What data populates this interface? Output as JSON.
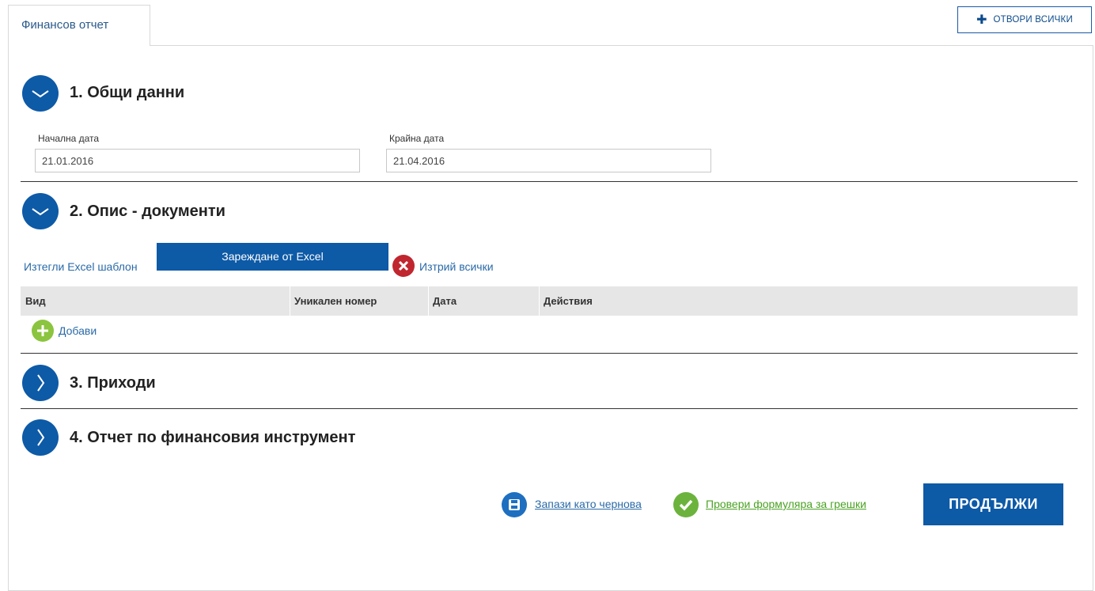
{
  "tabs": [
    {
      "label": "Финансов отчет",
      "active": true
    }
  ],
  "toolbar": {
    "expand_all_label": "ОТВОРИ ВСИЧКИ",
    "expand_all_icon": "plus-icon"
  },
  "sections": [
    {
      "title": "1. Общи данни",
      "state": "expanded",
      "icon": "chevron-down-icon"
    },
    {
      "title": "2. Опис - документи",
      "state": "expanded",
      "icon": "chevron-down-icon"
    },
    {
      "title": "3. Приходи",
      "state": "collapsed",
      "icon": "chevron-right-icon"
    },
    {
      "title": "4. Отчет по финансовия инструмент",
      "state": "collapsed",
      "icon": "chevron-right-icon"
    }
  ],
  "general": {
    "start_date_label": "Начална дата",
    "start_date_value": "21.01.2016",
    "end_date_label": "Крайна дата",
    "end_date_value": "21.04.2016"
  },
  "documents": {
    "download_template_label": "Изтегли Excel шаблон",
    "upload_excel_label": "Зареждане от Excel",
    "delete_all_label": "Изтрий всички",
    "columns": [
      "Вид",
      "Уникален номер",
      "Дата",
      "Действия"
    ],
    "rows": [],
    "add_label": "Добави"
  },
  "footer": {
    "save_draft_label": "Запази като чернова",
    "check_errors_label": "Провери формуляра за грешки",
    "continue_label": "ПРОДЪЛЖИ"
  },
  "colors": {
    "primary": "#0d5aa7",
    "link": "#2a6aa8",
    "success": "#6cb33e",
    "danger": "#c0262f",
    "add": "#8bc43f",
    "table_header_bg": "#e6e6e6"
  }
}
